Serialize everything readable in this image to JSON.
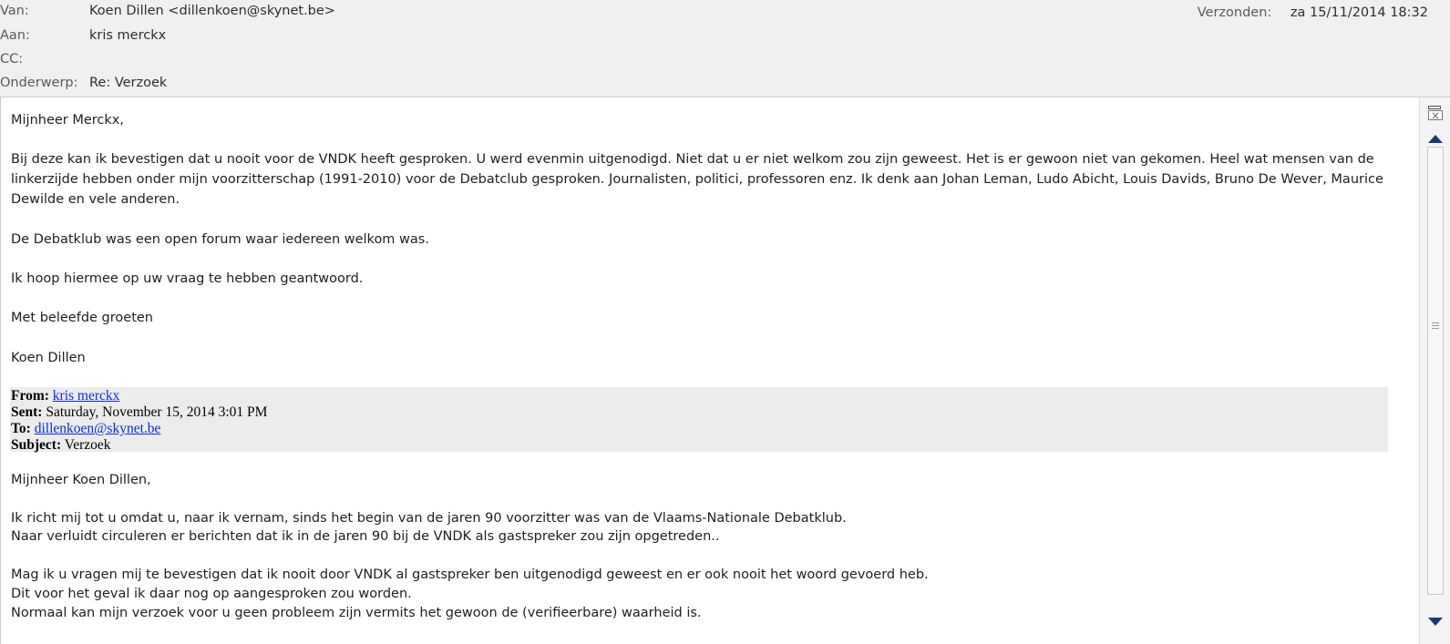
{
  "header": {
    "from_label": "Van:",
    "from_value": "Koen Dillen <dillenkoen@skynet.be>",
    "to_label": "Aan:",
    "to_value": "kris merckx",
    "cc_label": "CC:",
    "cc_value": "",
    "subject_label": "Onderwerp:",
    "subject_value": "Re: Verzoek",
    "sent_label": "Verzonden:",
    "sent_value": "za 15/11/2014 18:32"
  },
  "reply": {
    "greeting": "Mijnheer Merckx,",
    "p1": "Bij deze kan ik bevestigen dat u nooit voor de VNDK heeft gesproken. U werd evenmin uitgenodigd. Niet dat u er niet welkom zou zijn geweest. Het is er gewoon niet van gekomen. Heel wat mensen van de linkerzijde hebben onder mijn voorzitterschap (1991-2010) voor de Debatclub gesproken. Journalisten, politici, professoren enz. Ik denk aan Johan Leman, Ludo Abicht, Louis Davids, Bruno De Wever, Maurice Dewilde en vele anderen.",
    "p2": "De Debatklub was een open forum waar iedereen welkom was.",
    "p3": "Ik hoop hiermee op uw vraag te hebben geantwoord.",
    "closing": "Met beleefde groeten",
    "signature": "Koen Dillen"
  },
  "quoted_header": {
    "from_label": "From:",
    "from_value": "kris merckx",
    "sent_label": "Sent:",
    "sent_value": "Saturday, November 15, 2014 3:01 PM",
    "to_label": "To:",
    "to_value": "dillenkoen@skynet.be",
    "subject_label": "Subject:",
    "subject_value": "Verzoek"
  },
  "original": {
    "greeting": "Mijnheer Koen Dillen,",
    "line1": "Ik richt mij tot u omdat u, naar ik vernam, sinds het begin van de jaren 90 voorzitter was van de Vlaams-Nationale Debatklub.",
    "line2": "Naar verluidt circuleren er berichten dat ik in de jaren 90 bij de VNDK als gastspreker zou zijn opgetreden..",
    "line3": "Mag ik u vragen mij te bevestigen dat ik nooit door VNDK al gastspreker ben uitgenodigd geweest en er ook nooit het woord gevoerd heb.",
    "line4": "Dit voor het geval ik daar nog op aangesproken zou worden.",
    "line5": "Normaal kan mijn verzoek voor u geen probleem zijn vermits het gewoon de (verifieerbare) waarheid is."
  },
  "icons": {
    "scroll_up": "scroll-up-arrow-icon",
    "scroll_down": "scroll-down-arrow-icon",
    "split": "split-view-icon"
  }
}
